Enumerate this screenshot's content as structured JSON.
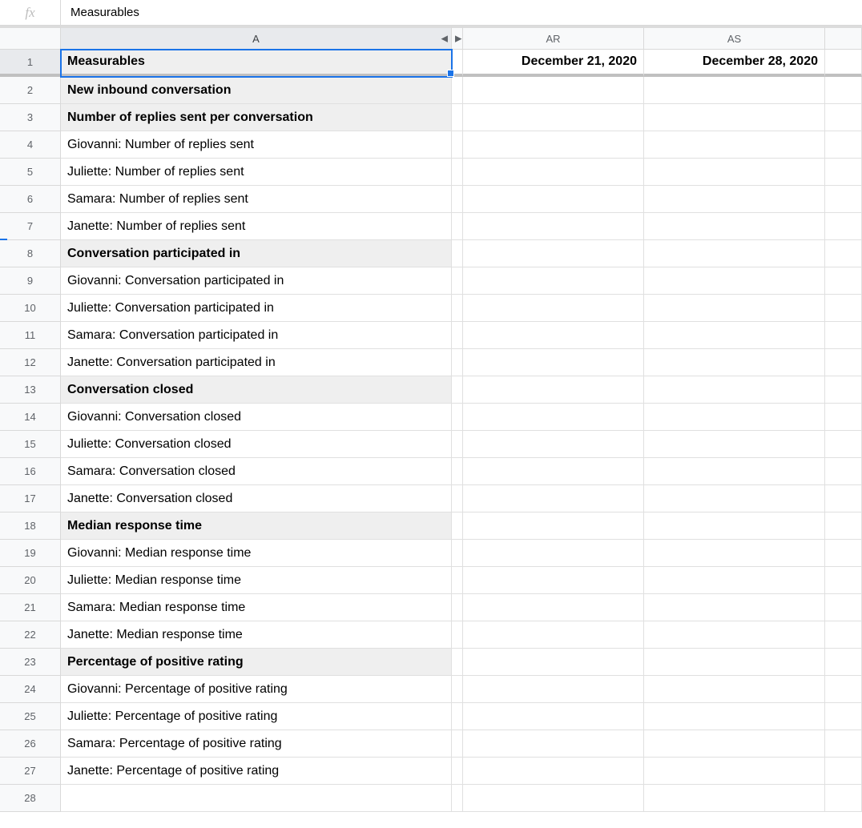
{
  "formula_bar": {
    "fx_label": "fx",
    "value": "Measurables"
  },
  "column_headers": {
    "corner": "",
    "a": "A",
    "gutter": "",
    "ar": "AR",
    "as": "AS",
    "tail": ""
  },
  "collapse_icon": "◀",
  "expand_icon": "▶",
  "rows": [
    {
      "n": "1",
      "a": "Measurables",
      "ar": "December 21, 2020",
      "as": "December 28, 2020",
      "group": true,
      "header_row": true
    },
    {
      "n": "2",
      "a": "New inbound conversation",
      "ar": "",
      "as": "",
      "group": true
    },
    {
      "n": "3",
      "a": "Number of replies sent per conversation",
      "ar": "",
      "as": "",
      "group": true
    },
    {
      "n": "4",
      "a": "Giovanni: Number of replies sent",
      "ar": "",
      "as": "",
      "group": false
    },
    {
      "n": "5",
      "a": "Juliette: Number of replies sent",
      "ar": "",
      "as": "",
      "group": false
    },
    {
      "n": "6",
      "a": "Samara: Number of replies sent",
      "ar": "",
      "as": "",
      "group": false
    },
    {
      "n": "7",
      "a": "Janette: Number of replies sent",
      "ar": "",
      "as": "",
      "group": false
    },
    {
      "n": "8",
      "a": "Conversation participated in",
      "ar": "",
      "as": "",
      "group": true
    },
    {
      "n": "9",
      "a": "Giovanni: Conversation participated in",
      "ar": "",
      "as": "",
      "group": false
    },
    {
      "n": "10",
      "a": "Juliette: Conversation participated in",
      "ar": "",
      "as": "",
      "group": false
    },
    {
      "n": "11",
      "a": "Samara: Conversation participated in",
      "ar": "",
      "as": "",
      "group": false
    },
    {
      "n": "12",
      "a": "Janette: Conversation participated in",
      "ar": "",
      "as": "",
      "group": false
    },
    {
      "n": "13",
      "a": "Conversation closed",
      "ar": "",
      "as": "",
      "group": true
    },
    {
      "n": "14",
      "a": "Giovanni: Conversation closed",
      "ar": "",
      "as": "",
      "group": false
    },
    {
      "n": "15",
      "a": "Juliette: Conversation closed",
      "ar": "",
      "as": "",
      "group": false
    },
    {
      "n": "16",
      "a": "Samara: Conversation closed",
      "ar": "",
      "as": "",
      "group": false
    },
    {
      "n": "17",
      "a": "Janette: Conversation closed",
      "ar": "",
      "as": "",
      "group": false
    },
    {
      "n": "18",
      "a": "Median response time",
      "ar": "",
      "as": "",
      "group": true
    },
    {
      "n": "19",
      "a": "Giovanni: Median response time",
      "ar": "",
      "as": "",
      "group": false
    },
    {
      "n": "20",
      "a": "Juliette: Median response time",
      "ar": "",
      "as": "",
      "group": false
    },
    {
      "n": "21",
      "a": "Samara: Median response time",
      "ar": "",
      "as": "",
      "group": false
    },
    {
      "n": "22",
      "a": "Janette: Median response time",
      "ar": "",
      "as": "",
      "group": false
    },
    {
      "n": "23",
      "a": "Percentage of positive rating",
      "ar": "",
      "as": "",
      "group": true
    },
    {
      "n": "24",
      "a": "Giovanni: Percentage of positive rating",
      "ar": "",
      "as": "",
      "group": false
    },
    {
      "n": "25",
      "a": "Juliette: Percentage of positive rating",
      "ar": "",
      "as": "",
      "group": false
    },
    {
      "n": "26",
      "a": "Samara: Percentage of positive rating",
      "ar": "",
      "as": "",
      "group": false
    },
    {
      "n": "27",
      "a": "Janette: Percentage of positive rating",
      "ar": "",
      "as": "",
      "group": false
    },
    {
      "n": "28",
      "a": "",
      "ar": "",
      "as": "",
      "group": false
    }
  ]
}
